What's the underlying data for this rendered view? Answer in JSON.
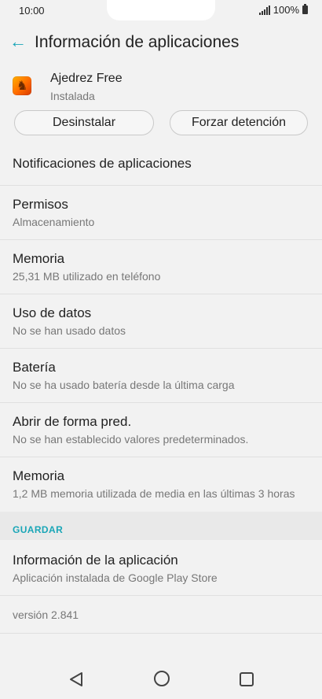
{
  "status_bar": {
    "time": "10:00",
    "battery_percent": "100%"
  },
  "header": {
    "back_icon": "arrow-left-icon",
    "title": "Información de aplicaciones"
  },
  "app": {
    "name": "Ajedrez Free",
    "state": "Instalada",
    "icon": "chess-app-icon"
  },
  "buttons": {
    "uninstall": "Desinstalar",
    "force_stop": "Forzar detención"
  },
  "list": {
    "notifications": {
      "title": "Notificaciones de aplicaciones"
    },
    "permissions": {
      "title": "Permisos",
      "subtitle": "Almacenamiento"
    },
    "memory": {
      "title": "Memoria",
      "subtitle": "25,31 MB utilizado en teléfono"
    },
    "data_usage": {
      "title": "Uso de datos",
      "subtitle": "No se han usado datos"
    },
    "battery": {
      "title": "Batería",
      "subtitle": "No se ha usado batería desde la última carga"
    },
    "open_default": {
      "title": "Abrir de forma pred.",
      "subtitle": "No se han establecido valores predeterminados."
    },
    "memory_avg": {
      "title": "Memoria",
      "subtitle": "1,2 MB memoria utilizada de media en las últimas 3 horas"
    }
  },
  "save_section": {
    "label": "GUARDAR",
    "info_title": "Información de la aplicación",
    "info_subtitle": "Aplicación instalada de Google Play Store"
  },
  "version": "versión 2.841",
  "colors": {
    "accent": "#1aa6b7",
    "background": "#f2f2f2"
  }
}
